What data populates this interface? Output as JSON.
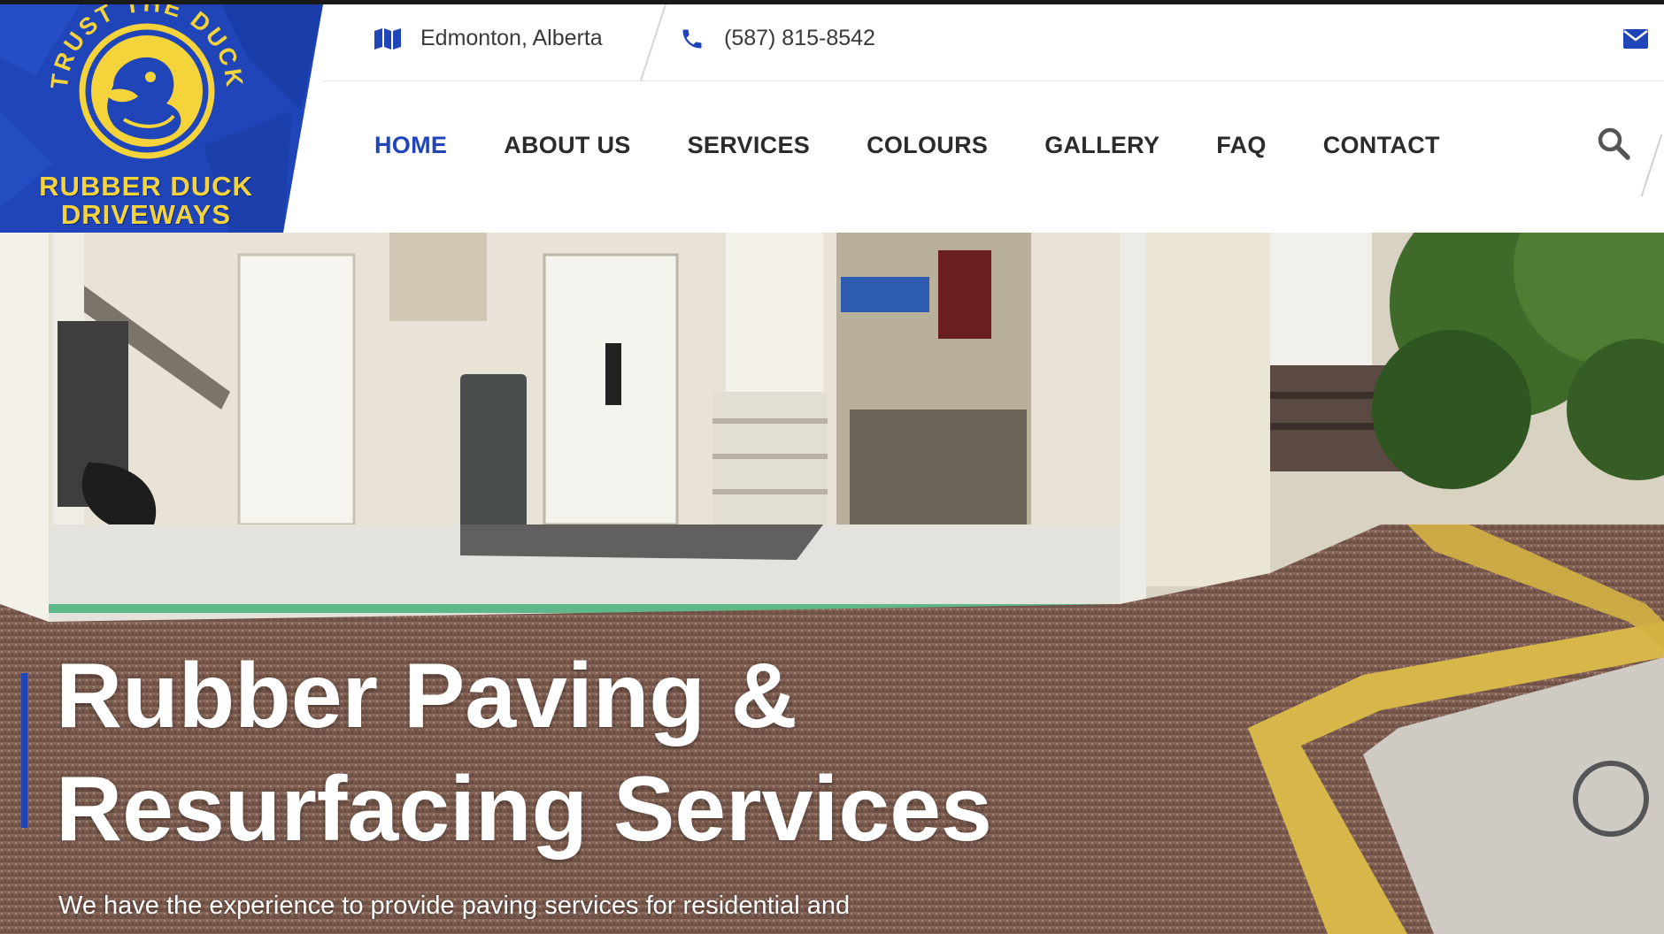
{
  "brand": {
    "arc_text": "TRUST THE DUCK",
    "name_line1": "RUBBER DUCK",
    "name_line2": "DRIVEWAYS",
    "colors": {
      "blue": "#1f45b8",
      "yellow": "#f5d33a"
    }
  },
  "topbar": {
    "location": "Edmonton, Alberta",
    "phone": "(587) 815-8542",
    "location_icon": "map-icon",
    "phone_icon": "phone-icon",
    "mail_icon": "envelope-icon"
  },
  "nav": {
    "items": [
      {
        "label": "HOME",
        "active": true
      },
      {
        "label": "ABOUT US"
      },
      {
        "label": "SERVICES"
      },
      {
        "label": "COLOURS"
      },
      {
        "label": "GALLERY"
      },
      {
        "label": "FAQ"
      },
      {
        "label": "CONTACT"
      }
    ],
    "search_icon": "search-icon"
  },
  "hero": {
    "title_line1": "Rubber Paving &",
    "title_line2": "Resurfacing Services",
    "subtitle": "We have the experience to provide paving services for residential and"
  }
}
